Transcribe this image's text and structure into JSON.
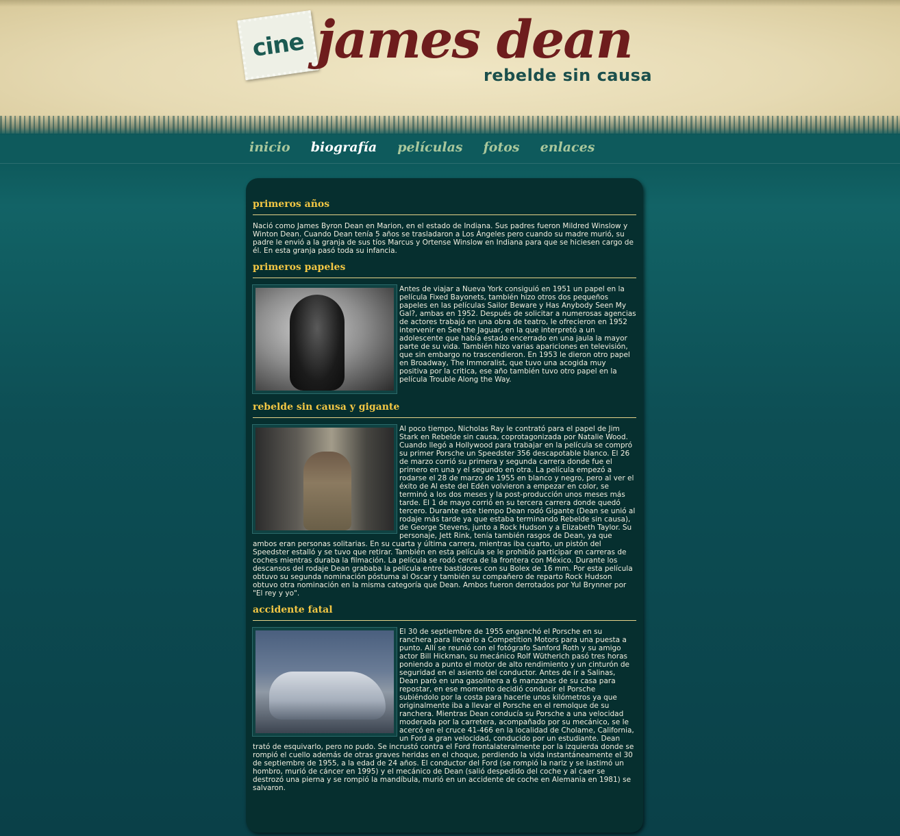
{
  "logo": {
    "stamp": "cine",
    "title": "james dean",
    "subtitle": "rebelde sin causa"
  },
  "nav": {
    "items": [
      "inicio",
      "biografía",
      "películas",
      "fotos",
      "enlaces"
    ],
    "active": "biografía"
  },
  "sections": [
    {
      "title": "primeros años",
      "text": "Nació como James Byron Dean en Marion, en el estado de Indiana. Sus padres fueron Mildred Winslow y Winton Dean. Cuando Dean tenía 5 años se trasladaron a Los Ángeles pero cuando su madre murió, su padre le envió a la granja de sus tíos Marcus y Ortense Winslow en Indiana para que se hiciesen cargo de él. En esta granja pasó toda su infancia."
    },
    {
      "title": "primeros papeles",
      "text": "Antes de viajar a Nueva York consiguió en 1951 un papel en la película Fixed Bayonets, también hizo otros dos pequeños papeles en las películas Sailor Beware y Has Anybody Seen My Gal?, ambas en 1952. Después de solicitar a numerosas agencias de actores trabajó en una obra de teatro, le ofrecieron en 1952 intervenir en See the Jaguar, en la que interpretó a un adolescente que había estado encerrado en una jaula la mayor parte de su vida. También hizo varias apariciones en televisión, que sin embargo no trascendieron. En 1953 le dieron otro papel en Broadway, The Immoralist, que tuvo una acogida muy positiva por la critica, ese año también tuvo otro papel en la película Trouble Along the Way."
    },
    {
      "title": "rebelde sin causa y gigante",
      "text": "Al poco tiempo, Nicholas Ray le contrató para el papel de Jim Stark en Rebelde sin causa, coprotagonizada por Natalie Wood. Cuando llegó a Hollywood para trabajar en la película se compró su primer Porsche un Speedster 356 descapotable blanco. El 26 de marzo corrió su primera y segunda carrera donde fue el primero en una y el segundo en otra. La película empezó a rodarse el 28 de marzo de 1955 en blanco y negro, pero al ver el éxito de Al este del Edén volvieron a empezar en color, se terminó a los dos meses y la post-producción unos meses más tarde. El 1 de mayo corrió en su tercera carrera donde quedó tercero. Durante este tiempo Dean rodó Gigante (Dean se unió al rodaje más tarde ya que estaba terminando Rebelde sin causa), de George Stevens, junto a Rock Hudson y a Elizabeth Taylor. Su personaje, Jett Rink, tenía también rasgos de Dean, ya que ambos eran personas solitarias. En su cuarta y última carrera, mientras iba cuarto, un pistón del Speedster estalló y se tuvo que retirar. También en esta película se le prohibió participar en carreras de coches mientras duraba la filmación. La película se rodó cerca de la frontera con México. Durante los descansos del rodaje Dean grababa la película entre bastidores con su Bolex de 16 mm. Por esta película obtuvo su segunda nominación póstuma al Oscar y también su compañero de reparto Rock Hudson obtuvo otra nominación en la misma categoría que Dean. Ambos fueron derrotados por Yul Brynner por \"El rey y yo\"."
    },
    {
      "title": "accidente fatal",
      "text": "El 30 de septiembre de 1955 enganchó el Porsche en su ranchera para llevarlo a Competition Motors para una puesta a punto. Allí se reunió con el fotógrafo Sanford Roth y su amigo actor Bill Hickman, su mecánico Rolf Wütherich pasó tres horas poniendo a punto el motor de alto rendimiento y un cinturón de seguridad en el asiento del conductor. Antes de ir a Salinas, Dean paró en una gasolinera a 6 manzanas de su casa para repostar, en ese momento decidió conducir el Porsche subiéndolo por la costa para hacerle unos kilómetros ya que originalmente iba a llevar el Porsche en el remolque de su ranchera. Mientras Dean conducía su Porsche a una velocidad moderada por la carretera, acompañado por su mecánico, se le acercó en el cruce 41-466 en la localidad de Cholame, California, un Ford a gran velocidad, conducido por un estudiante. Dean trató de esquivarlo, pero no pudo. Se incrustó contra el Ford frontalateralmente por la izquierda donde se rompió el cuello además de otras graves heridas en el choque, perdiendo la vida instantáneamente el 30 de septiembre de 1955, a la edad de 24 años. El conductor del Ford (se rompió la nariz y se lastimó un hombro, murió de cáncer en 1995) y el mecánico de Dean (salió despedido del coche y al caer se destrozó una pierna y se rompió la mandíbula, murió en un accidente de coche en Alemania en 1981) se salvaron."
    }
  ]
}
